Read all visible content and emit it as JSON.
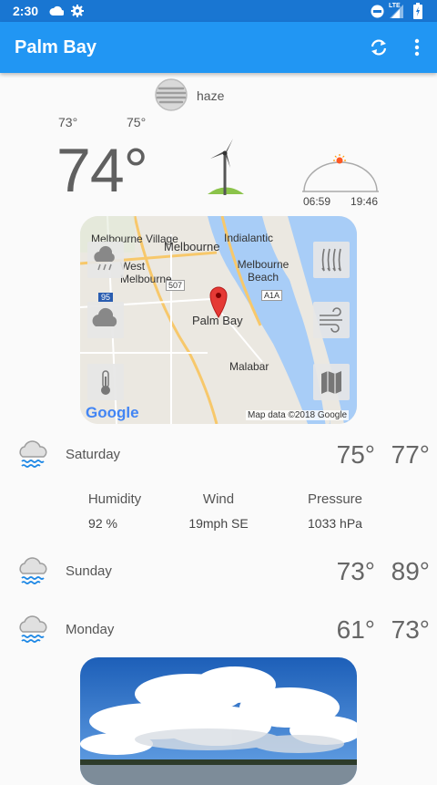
{
  "status": {
    "time": "2:30",
    "network": "LTE"
  },
  "app": {
    "title": "Palm Bay"
  },
  "current": {
    "condition": "haze",
    "temp_min": "73°",
    "temp_max": "75°",
    "temp": "74°",
    "sunrise": "06:59",
    "sunset": "19:46"
  },
  "map": {
    "labels": [
      "Melbourne Village",
      "Melbourne",
      "Indialantic",
      "West Melbourne",
      "Melbourne Beach",
      "Palm Bay",
      "Malabar",
      "507",
      "95",
      "A1A"
    ],
    "logo": "Google",
    "attribution": "Map data ©2018 Google"
  },
  "forecast": [
    {
      "day": "Saturday",
      "low": "75°",
      "high": "77°"
    },
    {
      "day": "Sunday",
      "low": "73°",
      "high": "89°"
    },
    {
      "day": "Monday",
      "low": "61°",
      "high": "73°"
    }
  ],
  "details": {
    "humidity_label": "Humidity",
    "humidity": "92 %",
    "wind_label": "Wind",
    "wind": "19mph SE",
    "pressure_label": "Pressure",
    "pressure": "1033 hPa"
  },
  "colors": {
    "appbar": "#2196f3",
    "statusbar": "#1976d2",
    "water": "#a8cdf7"
  },
  "icons": [
    "settings-icon",
    "dnd-icon",
    "signal-icon",
    "battery-icon",
    "refresh-icon",
    "more-vert-icon",
    "haze-icon",
    "wind-turbine-icon",
    "sun-arc-icon",
    "rain-cloud-icon",
    "map-pin-icon",
    "rain-layer-icon",
    "wind-layer-icon",
    "map-layer-icon",
    "cloud-layer-icon",
    "thermometer-icon"
  ]
}
